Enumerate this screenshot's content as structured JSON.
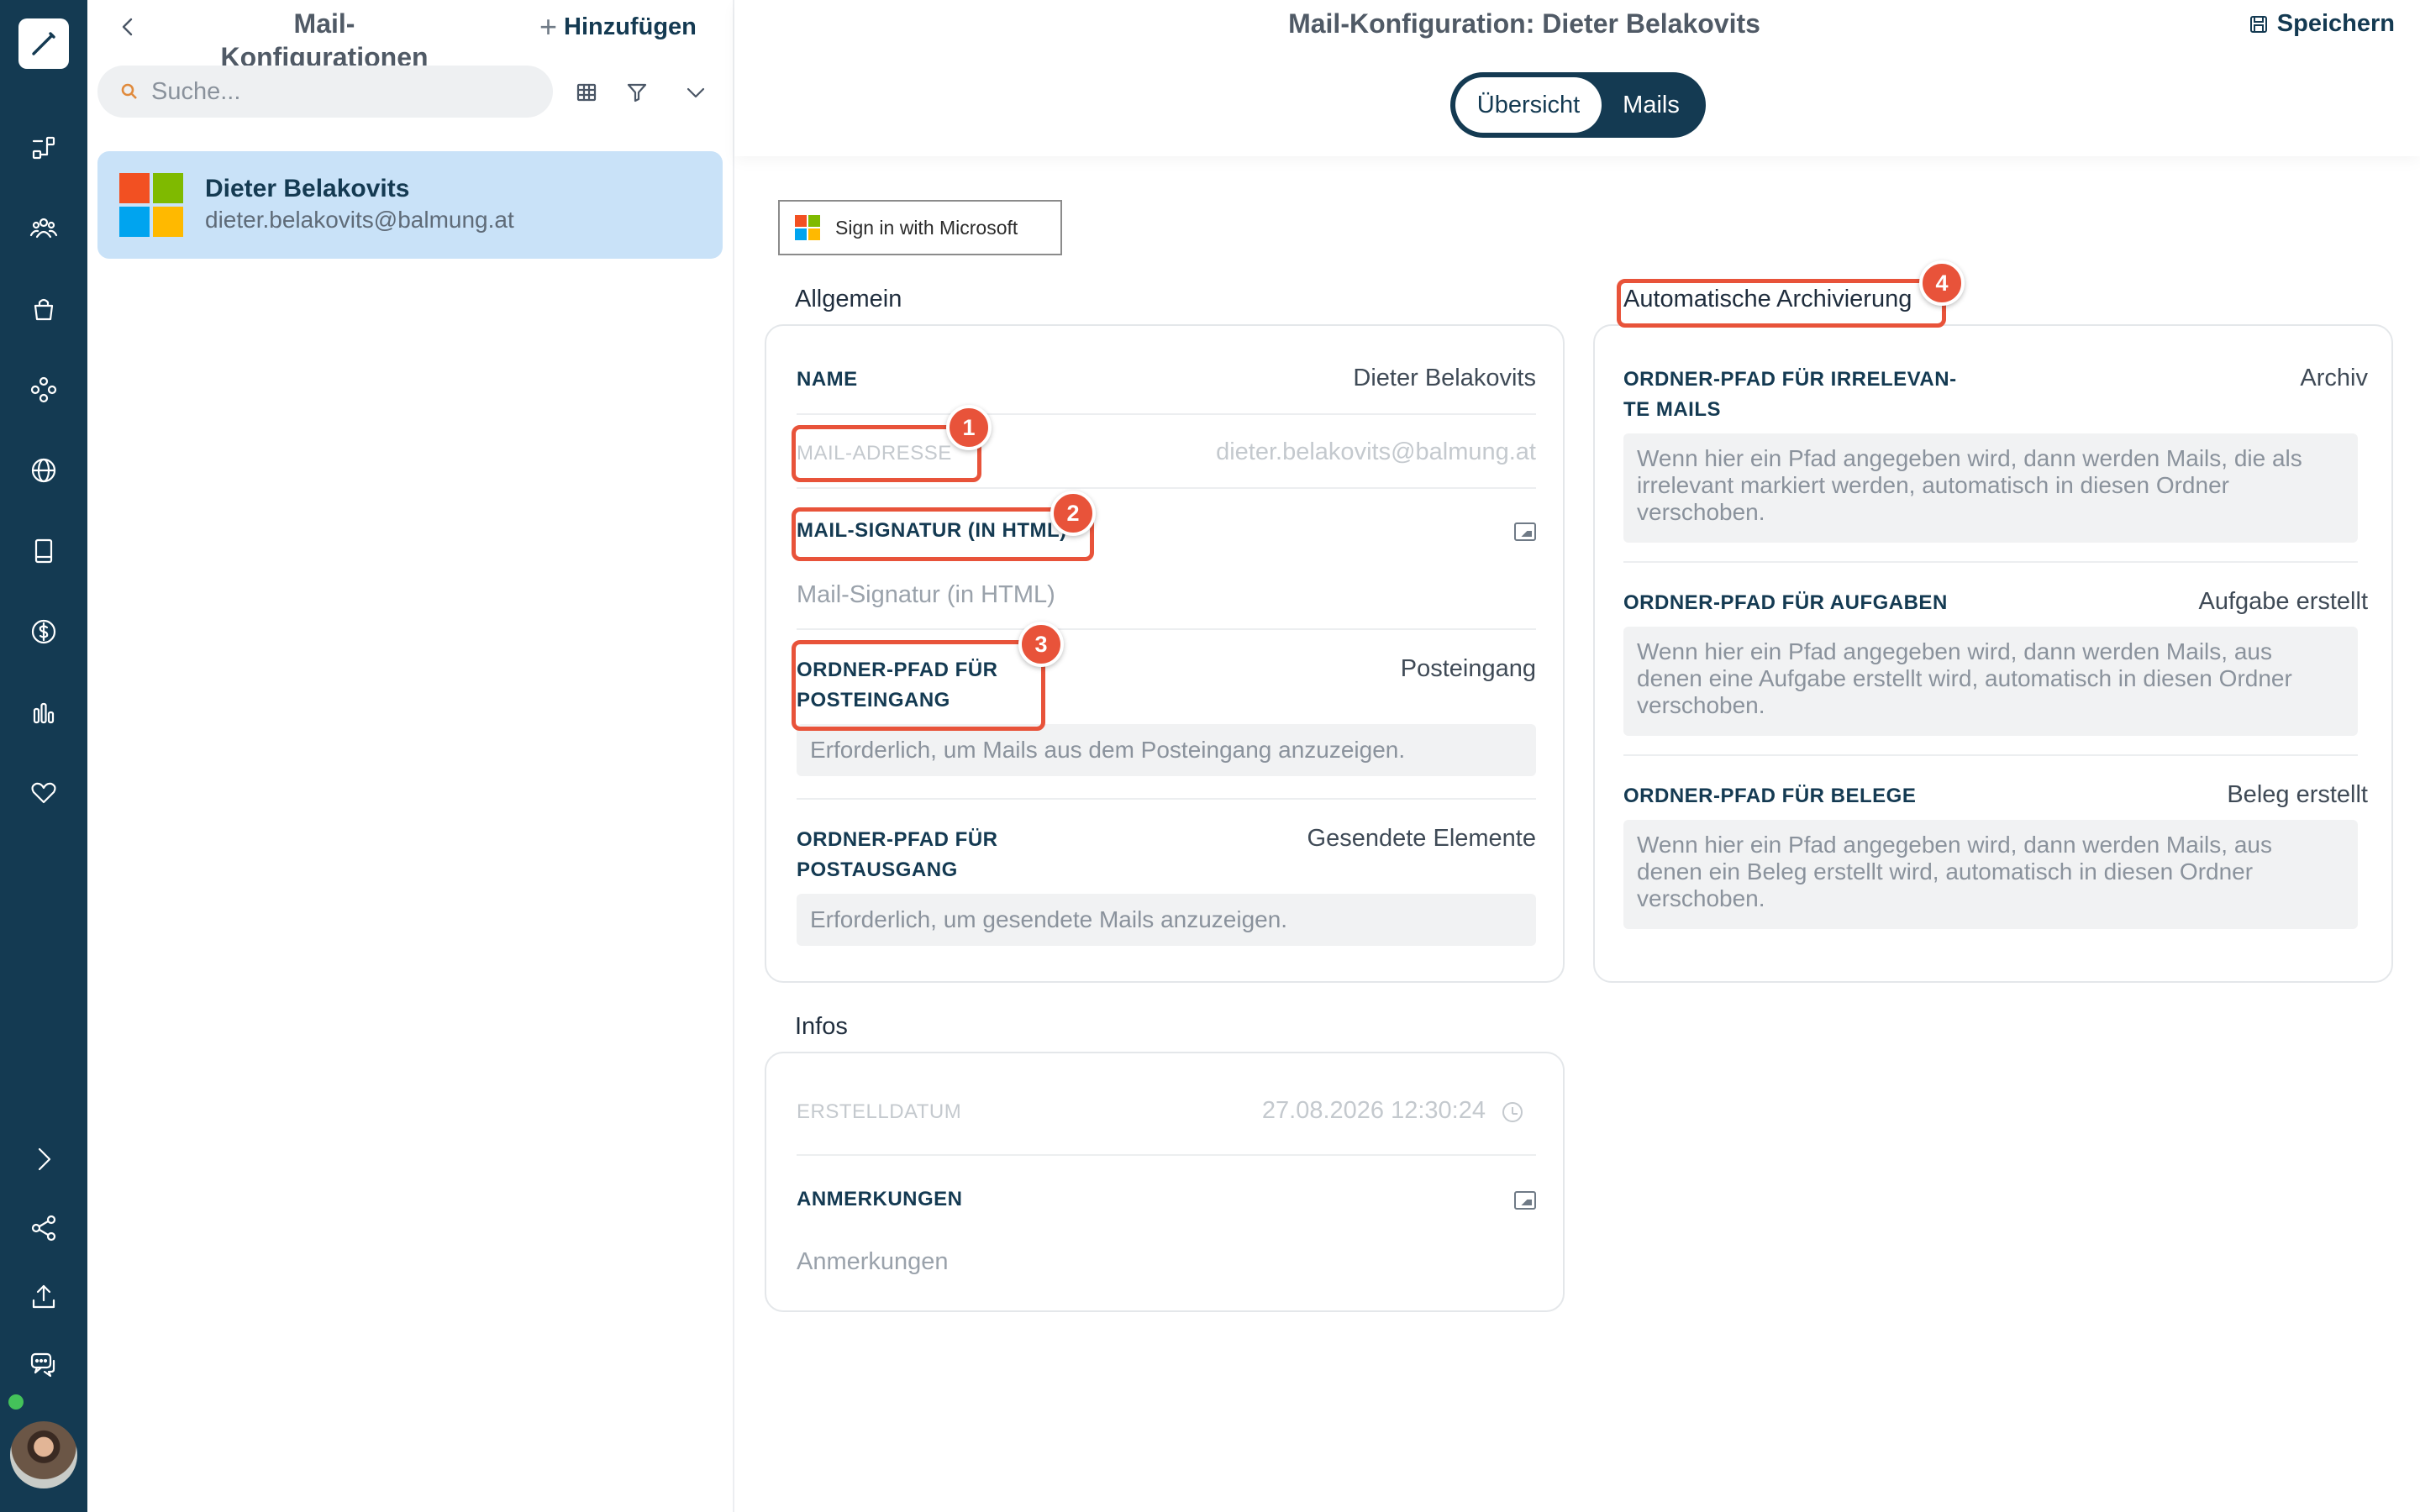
{
  "rail": {
    "icons": [
      "pen-icon",
      "workflow-icon",
      "people-icon",
      "bag-icon",
      "modules-icon",
      "globe-icon",
      "book-icon",
      "dollar-icon",
      "bar-chart-icon",
      "heart-icon",
      "chevron-right-icon",
      "share-icon",
      "upload-icon",
      "chat-icon"
    ]
  },
  "list": {
    "title": "Mail-Konfigurationen",
    "add_label": "Hinzufügen",
    "search_placeholder": "Suche...",
    "items": [
      {
        "name": "Dieter Belakovits",
        "email": "dieter.belakovits@balmung.at"
      }
    ]
  },
  "header": {
    "title": "Mail-Konfiguration: Dieter Belakovits",
    "save_label": "Speichern",
    "tabs": [
      {
        "label": "Übersicht",
        "active": true
      },
      {
        "label": "Mails",
        "active": false
      }
    ]
  },
  "signin_label": "Sign in with Microsoft",
  "allgemein": {
    "title": "Allgemein",
    "name_label": "NAME",
    "name_value": "Dieter Belakovits",
    "mail_label": "MAIL-ADRESSE",
    "mail_value": "dieter.belakovits@balmung.at",
    "signatur_label": "MAIL-SIGNATUR (IN HTML)",
    "signatur_placeholder": "Mail-Signatur (in HTML)",
    "posteingang_label_1": "ORDNER-PFAD FÜR",
    "posteingang_label_2": "POSTEINGANG",
    "posteingang_value": "Posteingang",
    "posteingang_hint": "Erforderlich, um Mails aus dem Posteingang anzuzeigen.",
    "postausgang_label_1": "ORDNER-PFAD FÜR",
    "postausgang_label_2": "POSTAUSGANG",
    "postausgang_value": "Gesendete Elemente",
    "postausgang_hint": "Erforderlich, um gesendete Mails anzuzeigen."
  },
  "archivierung": {
    "title": "Automatische Archivierung",
    "irrelevant_label_1": "ORDNER-PFAD FÜR IRRELEVAN-",
    "irrelevant_label_2": "TE MAILS",
    "irrelevant_value": "Archiv",
    "irrelevant_hint_1": "Wenn hier ein Pfad angegeben wird, dann werden Mails, die als",
    "irrelevant_hint_2": "irrelevant markiert werden, automatisch in diesen Ordner",
    "irrelevant_hint_3": "verschoben.",
    "aufgaben_label": "ORDNER-PFAD FÜR AUFGABEN",
    "aufgaben_value": "Aufgabe erstellt",
    "aufgaben_hint_1": "Wenn hier ein Pfad angegeben wird, dann werden Mails, aus",
    "aufgaben_hint_2": "denen eine Aufgabe erstellt wird, automatisch in diesen Ordner",
    "aufgaben_hint_3": "verschoben.",
    "belege_label": "ORDNER-PFAD FÜR BELEGE",
    "belege_value": "Beleg erstellt",
    "belege_hint_1": "Wenn hier ein Pfad angegeben wird, dann werden Mails, aus",
    "belege_hint_2": "denen ein Beleg erstellt wird, automatisch in diesen Ordner",
    "belege_hint_3": "verschoben."
  },
  "infos": {
    "title": "Infos",
    "erstelldatum_label": "ERSTELLDATUM",
    "erstelldatum_value": "27.08.2026 12:30:24",
    "anmerkungen_label": "ANMERKUNGEN",
    "anmerkungen_placeholder": "Anmerkungen"
  },
  "annotations": [
    "1",
    "2",
    "3",
    "4"
  ],
  "colors": {
    "rail": "#143a52",
    "selected_item": "#c9e2f8",
    "highlight": "#e8533a",
    "ms_red": "#f25022",
    "ms_green": "#7fba00",
    "ms_blue": "#00a4ef",
    "ms_yellow": "#ffb900"
  }
}
